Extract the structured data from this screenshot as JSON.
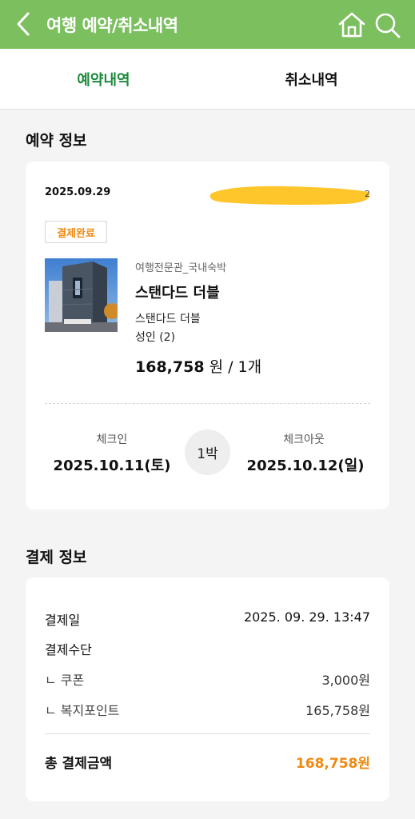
{
  "header": {
    "title": "여행 예약/취소내역",
    "back_icon": "chevron-left-icon",
    "home_icon": "home-icon",
    "search_icon": "search-icon",
    "bar_color": "#7bbf5f"
  },
  "tabs": [
    {
      "label": "예약내역",
      "active": true
    },
    {
      "label": "취소내역",
      "active": false
    }
  ],
  "reservation_section": {
    "title": "예약 정보",
    "date": "2025.09.29",
    "status": "결제완료",
    "provider": "여행전문관_국내숙박",
    "room_name": "스탠다드 더블",
    "room_type": "스탠다드 더블",
    "guests": "성인 (2)",
    "price_amount": "168,758",
    "price_suffix": " 원 / 1개",
    "checkin_label": "체크인",
    "checkin_date": "2025.10.11(토)",
    "nights": "1박",
    "checkout_label": "체크아웃",
    "checkout_date": "2025.10.12(일)"
  },
  "payment_section": {
    "title": "결제 정보",
    "pay_date_label": "결제일",
    "pay_date_value": "2025. 09. 29. 13:47",
    "method_label": "결제수단",
    "coupon_label": "ㄴ 쿠폰",
    "coupon_value": "3,000원",
    "points_label": "ㄴ 복지포인트",
    "points_value": "165,758원",
    "total_label": "총 결제금액",
    "total_value": "168,758원"
  },
  "colors": {
    "accent_green": "#1c8a3b",
    "accent_orange": "#ef8a12",
    "redaction_yellow": "#ffc62b"
  }
}
